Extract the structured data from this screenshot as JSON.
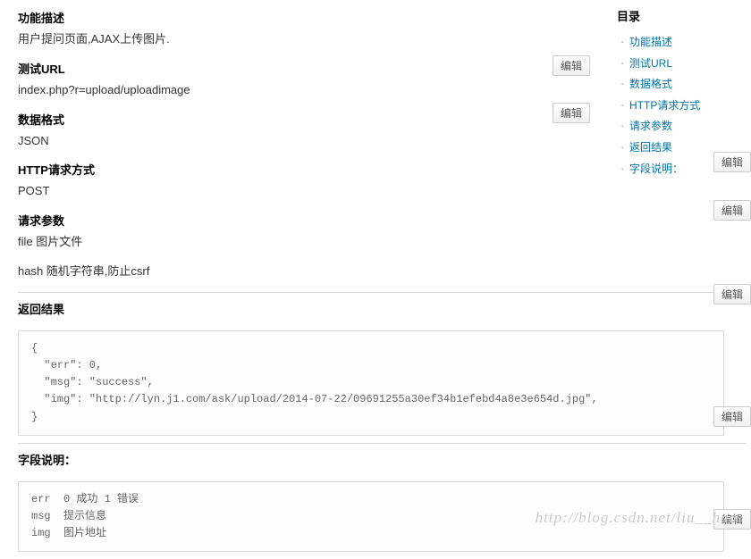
{
  "sections": {
    "s1": {
      "title": "功能描述",
      "body": "用户提问页面,AJAX上传图片."
    },
    "s2": {
      "title": "测试URL",
      "body": "index.php?r=upload/uploadimage"
    },
    "s3": {
      "title": "数据格式",
      "body": "JSON"
    },
    "s4": {
      "title": "HTTP请求方式",
      "body": "POST"
    },
    "s5": {
      "title": "请求参数",
      "body1": "file 图片文件",
      "body2": "hash 随机字符串,防止csrf"
    },
    "s6": {
      "title": "返回结果",
      "code": "{\n  \"err\": 0,\n  \"msg\": \"success\",\n  \"img\": \"http://lyn.j1.com/ask/upload/2014-07-22/09691255a30ef34b1efebd4a8e3e654d.jpg\",\n}"
    },
    "s7": {
      "title": "字段说明：",
      "code": "err  0 成功 1 错误\nmsg  提示信息\nimg  图片地址"
    }
  },
  "toc": {
    "title": "目录",
    "items": [
      "功能描述",
      "测试URL",
      "数据格式",
      "HTTP请求方式",
      "请求参数",
      "返回结果",
      "字段说明："
    ]
  },
  "edit_label": "编辑",
  "watermark": "http://blog.csdn.net/liu__hua"
}
